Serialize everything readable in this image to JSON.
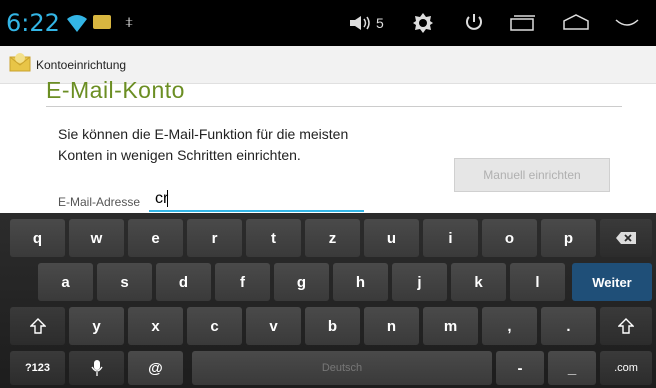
{
  "status_bar": {
    "time": "6:22",
    "volume_level": "5",
    "icons": [
      "wifi-icon",
      "notification-icon",
      "usb-debug-icon",
      "volume-icon",
      "brightness-icon",
      "power-icon",
      "recent-apps-icon",
      "home-icon",
      "back-icon"
    ]
  },
  "action_bar": {
    "title": "Kontoeinrichtung",
    "app_icon": "email-icon"
  },
  "content": {
    "heading": "E-Mail-Konto",
    "description_line1": "Sie können die E-Mail-Funktion für die meisten",
    "description_line2": "Konten in wenigen Schritten einrichten.",
    "manual_setup_label": "Manuell einrichten",
    "email_label": "E-Mail-Adresse",
    "email_value": "cr"
  },
  "keyboard": {
    "row1": [
      "q",
      "w",
      "e",
      "r",
      "t",
      "z",
      "u",
      "i",
      "o",
      "p"
    ],
    "row2": [
      "a",
      "s",
      "d",
      "f",
      "g",
      "h",
      "j",
      "k",
      "l"
    ],
    "row2_action": "Weiter",
    "row3": [
      "y",
      "x",
      "c",
      "v",
      "b",
      "n",
      "m",
      ",",
      "."
    ],
    "row4_left": "?123",
    "row4_at": "@",
    "row4_space": "Deutsch",
    "row4_dash": "-",
    "row4_underscore": "_",
    "row4_com": ".com",
    "accent_color": "#33b5e5",
    "heading_color": "#6b8e23"
  }
}
